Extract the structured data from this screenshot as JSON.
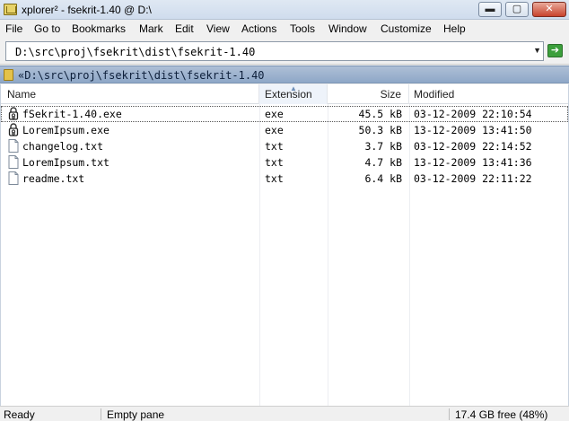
{
  "window": {
    "title": "xplorer² - fsekrit-1.40 @ D:\\",
    "min_symbol": "▬",
    "max_symbol": "▢",
    "close_symbol": "✕"
  },
  "menu": [
    {
      "label": "File"
    },
    {
      "label": "Go to"
    },
    {
      "label": "Bookmarks"
    },
    {
      "label": "Mark"
    },
    {
      "label": "Edit"
    },
    {
      "label": "View"
    },
    {
      "label": "Actions"
    },
    {
      "label": "Tools"
    },
    {
      "label": "Window"
    },
    {
      "label": "Customize"
    },
    {
      "label": "Help"
    }
  ],
  "address": {
    "value": "D:\\src\\proj\\fsekrit\\dist\\fsekrit-1.40",
    "go_symbol": "➔"
  },
  "pathbar": {
    "text": "«D:\\src\\proj\\fsekrit\\dist\\fsekrit-1.40"
  },
  "columns": {
    "name": "Name",
    "extension": "Extension",
    "size": "Size",
    "modified": "Modified"
  },
  "files": [
    {
      "name": "fSekrit-1.40.exe",
      "ext": "exe",
      "size": "45.5 kB",
      "modified": "03-12-2009 22:10:54",
      "icon": "lock-exe-icon",
      "focused": true
    },
    {
      "name": "LoremIpsum.exe",
      "ext": "exe",
      "size": "50.3 kB",
      "modified": "13-12-2009 13:41:50",
      "icon": "lock-exe-icon",
      "focused": false
    },
    {
      "name": "changelog.txt",
      "ext": "txt",
      "size": "3.7 kB",
      "modified": "03-12-2009 22:14:52",
      "icon": "text-file-icon",
      "focused": false
    },
    {
      "name": "LoremIpsum.txt",
      "ext": "txt",
      "size": "4.7 kB",
      "modified": "13-12-2009 13:41:36",
      "icon": "text-file-icon",
      "focused": false
    },
    {
      "name": "readme.txt",
      "ext": "txt",
      "size": "6.4 kB",
      "modified": "03-12-2009 22:11:22",
      "icon": "text-file-icon",
      "focused": false
    }
  ],
  "status": {
    "state": "Ready",
    "pane": "Empty pane",
    "free": "17.4 GB free (48%)"
  }
}
